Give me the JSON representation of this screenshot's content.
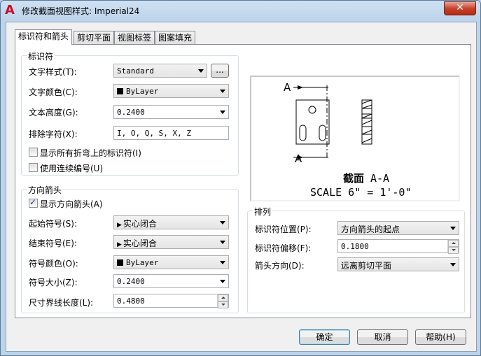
{
  "window": {
    "title": "修改截面视图样式: Imperial24",
    "close_symbol": "✕",
    "app_icon_letter": "A"
  },
  "tabs": [
    {
      "label": "标识符和箭头",
      "active": true
    },
    {
      "label": "剪切平面",
      "active": false
    },
    {
      "label": "视图标签",
      "active": false
    },
    {
      "label": "图案填充",
      "active": false
    }
  ],
  "identifier": {
    "title": "标识符",
    "text_style_label": "文字样式(T):",
    "text_style_value": "Standard",
    "browse_label": "...",
    "text_color_label": "文字颜色(C):",
    "text_color_value": "ByLayer",
    "text_height_label": "文本高度(G):",
    "text_height_value": "0.2400",
    "exclude_label": "排除字符(X):",
    "exclude_value": "I, O, Q, S, X, Z",
    "show_all_bend_label": "显示所有折弯上的标识符(I)",
    "show_all_bend_checked": false,
    "continuous_label": "使用连续编号(U)",
    "continuous_checked": false
  },
  "direction_arrows": {
    "title": "方向箭头",
    "show_label": "显示方向箭头(A)",
    "show_checked": true,
    "start_label": "起始符号(S):",
    "start_value": "实心闭合",
    "end_label": "结束符号(E):",
    "end_value": "实心闭合",
    "color_label": "符号颜色(O):",
    "color_value": "ByLayer",
    "size_label": "符号大小(Z):",
    "size_value": "0.2400",
    "ext_label": "尺寸界线长度(L):",
    "ext_value": "0.4800"
  },
  "layout": {
    "title": "排列",
    "id_pos_label": "标识符位置(P):",
    "id_pos_value": "方向箭头的起点",
    "id_offset_label": "标识符偏移(F):",
    "id_offset_value": "0.1800",
    "arrow_dir_label": "箭头方向(D):",
    "arrow_dir_value": "远离剪切平面"
  },
  "preview": {
    "marker_top": "A",
    "marker_bottom": "A",
    "label_bold": "截面",
    "label_id": "A-A",
    "scale_text": "SCALE 6\" = 1'-0\""
  },
  "buttons": {
    "ok": "确定",
    "cancel": "取消",
    "help": "帮助(H)"
  }
}
